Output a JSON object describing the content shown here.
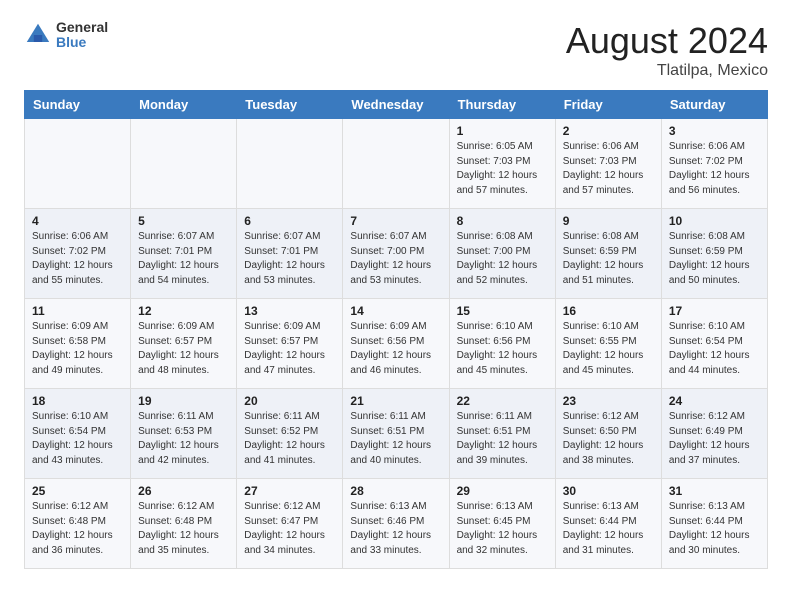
{
  "logo": {
    "line1": "General",
    "line2": "Blue"
  },
  "title": "August 2024",
  "subtitle": "Tlatilpa, Mexico",
  "weekdays": [
    "Sunday",
    "Monday",
    "Tuesday",
    "Wednesday",
    "Thursday",
    "Friday",
    "Saturday"
  ],
  "weeks": [
    [
      {
        "day": "",
        "sunrise": "",
        "sunset": "",
        "daylight": ""
      },
      {
        "day": "",
        "sunrise": "",
        "sunset": "",
        "daylight": ""
      },
      {
        "day": "",
        "sunrise": "",
        "sunset": "",
        "daylight": ""
      },
      {
        "day": "",
        "sunrise": "",
        "sunset": "",
        "daylight": ""
      },
      {
        "day": "1",
        "sunrise": "Sunrise: 6:05 AM",
        "sunset": "Sunset: 7:03 PM",
        "daylight": "Daylight: 12 hours and 57 minutes."
      },
      {
        "day": "2",
        "sunrise": "Sunrise: 6:06 AM",
        "sunset": "Sunset: 7:03 PM",
        "daylight": "Daylight: 12 hours and 57 minutes."
      },
      {
        "day": "3",
        "sunrise": "Sunrise: 6:06 AM",
        "sunset": "Sunset: 7:02 PM",
        "daylight": "Daylight: 12 hours and 56 minutes."
      }
    ],
    [
      {
        "day": "4",
        "sunrise": "Sunrise: 6:06 AM",
        "sunset": "Sunset: 7:02 PM",
        "daylight": "Daylight: 12 hours and 55 minutes."
      },
      {
        "day": "5",
        "sunrise": "Sunrise: 6:07 AM",
        "sunset": "Sunset: 7:01 PM",
        "daylight": "Daylight: 12 hours and 54 minutes."
      },
      {
        "day": "6",
        "sunrise": "Sunrise: 6:07 AM",
        "sunset": "Sunset: 7:01 PM",
        "daylight": "Daylight: 12 hours and 53 minutes."
      },
      {
        "day": "7",
        "sunrise": "Sunrise: 6:07 AM",
        "sunset": "Sunset: 7:00 PM",
        "daylight": "Daylight: 12 hours and 53 minutes."
      },
      {
        "day": "8",
        "sunrise": "Sunrise: 6:08 AM",
        "sunset": "Sunset: 7:00 PM",
        "daylight": "Daylight: 12 hours and 52 minutes."
      },
      {
        "day": "9",
        "sunrise": "Sunrise: 6:08 AM",
        "sunset": "Sunset: 6:59 PM",
        "daylight": "Daylight: 12 hours and 51 minutes."
      },
      {
        "day": "10",
        "sunrise": "Sunrise: 6:08 AM",
        "sunset": "Sunset: 6:59 PM",
        "daylight": "Daylight: 12 hours and 50 minutes."
      }
    ],
    [
      {
        "day": "11",
        "sunrise": "Sunrise: 6:09 AM",
        "sunset": "Sunset: 6:58 PM",
        "daylight": "Daylight: 12 hours and 49 minutes."
      },
      {
        "day": "12",
        "sunrise": "Sunrise: 6:09 AM",
        "sunset": "Sunset: 6:57 PM",
        "daylight": "Daylight: 12 hours and 48 minutes."
      },
      {
        "day": "13",
        "sunrise": "Sunrise: 6:09 AM",
        "sunset": "Sunset: 6:57 PM",
        "daylight": "Daylight: 12 hours and 47 minutes."
      },
      {
        "day": "14",
        "sunrise": "Sunrise: 6:09 AM",
        "sunset": "Sunset: 6:56 PM",
        "daylight": "Daylight: 12 hours and 46 minutes."
      },
      {
        "day": "15",
        "sunrise": "Sunrise: 6:10 AM",
        "sunset": "Sunset: 6:56 PM",
        "daylight": "Daylight: 12 hours and 45 minutes."
      },
      {
        "day": "16",
        "sunrise": "Sunrise: 6:10 AM",
        "sunset": "Sunset: 6:55 PM",
        "daylight": "Daylight: 12 hours and 45 minutes."
      },
      {
        "day": "17",
        "sunrise": "Sunrise: 6:10 AM",
        "sunset": "Sunset: 6:54 PM",
        "daylight": "Daylight: 12 hours and 44 minutes."
      }
    ],
    [
      {
        "day": "18",
        "sunrise": "Sunrise: 6:10 AM",
        "sunset": "Sunset: 6:54 PM",
        "daylight": "Daylight: 12 hours and 43 minutes."
      },
      {
        "day": "19",
        "sunrise": "Sunrise: 6:11 AM",
        "sunset": "Sunset: 6:53 PM",
        "daylight": "Daylight: 12 hours and 42 minutes."
      },
      {
        "day": "20",
        "sunrise": "Sunrise: 6:11 AM",
        "sunset": "Sunset: 6:52 PM",
        "daylight": "Daylight: 12 hours and 41 minutes."
      },
      {
        "day": "21",
        "sunrise": "Sunrise: 6:11 AM",
        "sunset": "Sunset: 6:51 PM",
        "daylight": "Daylight: 12 hours and 40 minutes."
      },
      {
        "day": "22",
        "sunrise": "Sunrise: 6:11 AM",
        "sunset": "Sunset: 6:51 PM",
        "daylight": "Daylight: 12 hours and 39 minutes."
      },
      {
        "day": "23",
        "sunrise": "Sunrise: 6:12 AM",
        "sunset": "Sunset: 6:50 PM",
        "daylight": "Daylight: 12 hours and 38 minutes."
      },
      {
        "day": "24",
        "sunrise": "Sunrise: 6:12 AM",
        "sunset": "Sunset: 6:49 PM",
        "daylight": "Daylight: 12 hours and 37 minutes."
      }
    ],
    [
      {
        "day": "25",
        "sunrise": "Sunrise: 6:12 AM",
        "sunset": "Sunset: 6:48 PM",
        "daylight": "Daylight: 12 hours and 36 minutes."
      },
      {
        "day": "26",
        "sunrise": "Sunrise: 6:12 AM",
        "sunset": "Sunset: 6:48 PM",
        "daylight": "Daylight: 12 hours and 35 minutes."
      },
      {
        "day": "27",
        "sunrise": "Sunrise: 6:12 AM",
        "sunset": "Sunset: 6:47 PM",
        "daylight": "Daylight: 12 hours and 34 minutes."
      },
      {
        "day": "28",
        "sunrise": "Sunrise: 6:13 AM",
        "sunset": "Sunset: 6:46 PM",
        "daylight": "Daylight: 12 hours and 33 minutes."
      },
      {
        "day": "29",
        "sunrise": "Sunrise: 6:13 AM",
        "sunset": "Sunset: 6:45 PM",
        "daylight": "Daylight: 12 hours and 32 minutes."
      },
      {
        "day": "30",
        "sunrise": "Sunrise: 6:13 AM",
        "sunset": "Sunset: 6:44 PM",
        "daylight": "Daylight: 12 hours and 31 minutes."
      },
      {
        "day": "31",
        "sunrise": "Sunrise: 6:13 AM",
        "sunset": "Sunset: 6:44 PM",
        "daylight": "Daylight: 12 hours and 30 minutes."
      }
    ]
  ]
}
